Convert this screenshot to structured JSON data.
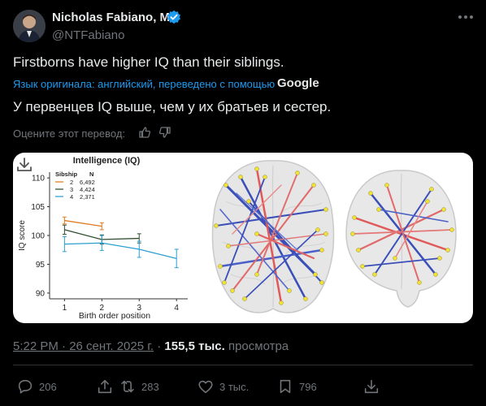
{
  "author": {
    "name": "Nicholas Fabiano, MD",
    "handle": "@NTFabiano"
  },
  "tweet": {
    "text_original": "Firstborns have higher IQ than their siblings.",
    "translated_note": "Язык оригинала: английский, переведено с помощью",
    "translator_brand": "Google",
    "text_translated": "У первенцев IQ выше, чем у их братьев и сестер.",
    "rate_prompt": "Оцените этот перевод:"
  },
  "meta": {
    "time_date": "5:22 PM · 26 сент. 2025 г.",
    "separator": "·",
    "views_count": "155,5 тыс.",
    "views_label": "просмотра"
  },
  "actions": {
    "replies": "206",
    "reposts": "283",
    "likes": "3 тыс.",
    "bookmarks": "796"
  },
  "colors": {
    "accent": "#1d9bf0",
    "verified": "#1d9bf0",
    "sib2": "#e07b22",
    "sib3": "#2f4f2f",
    "sib4": "#2d9fd0"
  },
  "chart_data": {
    "type": "line",
    "title": "Intelligence (IQ)",
    "xlabel": "Birth order position",
    "ylabel": "IQ score",
    "xlim": [
      0.6,
      4.3
    ],
    "ylim": [
      89,
      111
    ],
    "xticks": [
      "1",
      "2",
      "3",
      "4"
    ],
    "yticks": [
      "90",
      "95",
      "100",
      "105",
      "110"
    ],
    "legend_header": [
      "Sibship",
      "N"
    ],
    "series": [
      {
        "name": "2",
        "n": "6,492",
        "x": [
          1,
          2
        ],
        "values": [
          102.6,
          101.6
        ],
        "err": [
          0.6,
          0.6
        ]
      },
      {
        "name": "3",
        "n": "4,424",
        "x": [
          1,
          2,
          3
        ],
        "values": [
          101.0,
          99.3,
          99.5
        ],
        "err": [
          0.8,
          0.8,
          0.8
        ]
      },
      {
        "name": "4",
        "n": "2,371",
        "x": [
          1,
          2,
          3,
          4
        ],
        "values": [
          98.5,
          98.7,
          97.6,
          96.0
        ],
        "err": [
          1.3,
          1.3,
          1.4,
          1.6
        ]
      }
    ]
  }
}
